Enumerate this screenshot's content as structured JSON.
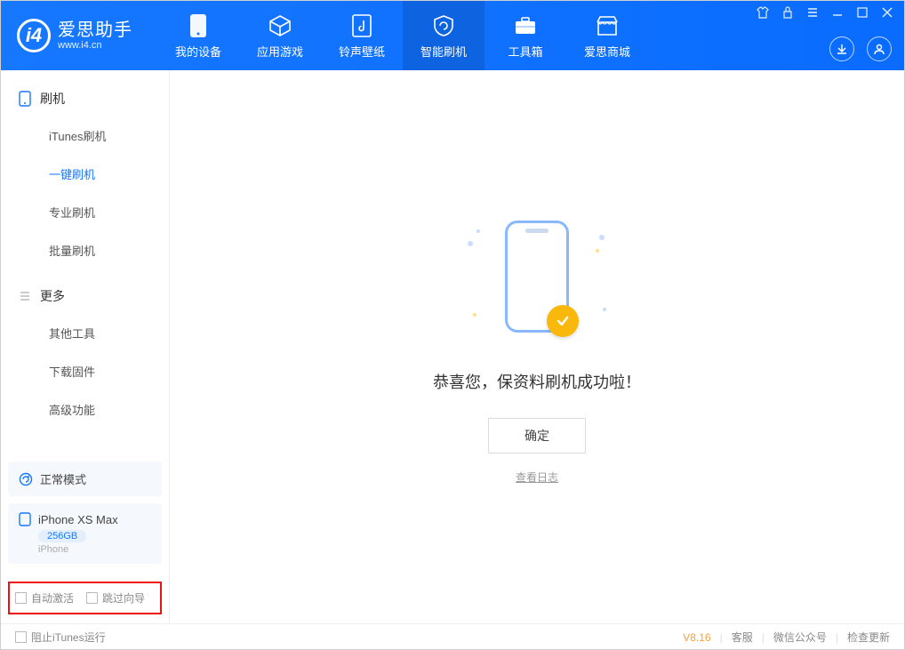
{
  "app": {
    "title": "爱思助手",
    "subtitle": "www.i4.cn"
  },
  "nav": {
    "items": [
      {
        "label": "我的设备"
      },
      {
        "label": "应用游戏"
      },
      {
        "label": "铃声壁纸"
      },
      {
        "label": "智能刷机"
      },
      {
        "label": "工具箱"
      },
      {
        "label": "爱思商城"
      }
    ]
  },
  "sidebar": {
    "group1_title": "刷机",
    "group1_items": [
      "iTunes刷机",
      "一键刷机",
      "专业刷机",
      "批量刷机"
    ],
    "group2_title": "更多",
    "group2_items": [
      "其他工具",
      "下载固件",
      "高级功能"
    ],
    "mode_card": "正常模式",
    "device_card": {
      "name": "iPhone XS Max",
      "storage": "256GB",
      "type": "iPhone"
    },
    "opt1": "自动激活",
    "opt2": "跳过向导"
  },
  "main": {
    "message": "恭喜您，保资料刷机成功啦！",
    "ok": "确定",
    "log": "查看日志"
  },
  "footer": {
    "block_itunes": "阻止iTunes运行",
    "version": "V8.16",
    "links": [
      "客服",
      "微信公众号",
      "检查更新"
    ]
  }
}
